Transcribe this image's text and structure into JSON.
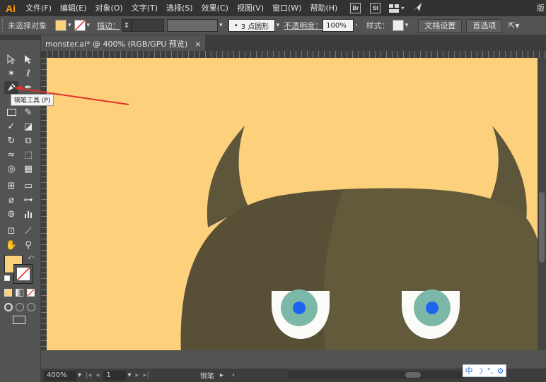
{
  "app": {
    "logo": "Ai"
  },
  "menu": {
    "items": [
      "文件(F)",
      "编辑(E)",
      "对象(O)",
      "文字(T)",
      "选择(S)",
      "效果(C)",
      "视图(V)",
      "窗口(W)",
      "帮助(H)"
    ],
    "bridge": "Br",
    "stock": "St",
    "right_text": "版"
  },
  "control": {
    "no_selection": "未选择对象",
    "fill_color": "#fdd17c",
    "stroke_label": "描边：",
    "brush_label": "3 点圆形",
    "opacity_label": "不透明度：",
    "opacity_value": "100%",
    "style_label": "样式：",
    "doc_settings": "文档设置",
    "preferences": "首选项"
  },
  "document": {
    "tab_title": "monster.ai* @ 400% (RGB/GPU 预览)",
    "close": "×"
  },
  "tooltip": "钢笔工具 (P)",
  "status": {
    "zoom": "400%",
    "artboard": "1",
    "tool_name": "钢笔"
  },
  "ime": {
    "lang": "中",
    "moon": "☽",
    "punct": "°,",
    "gear": "⚙"
  },
  "colors": {
    "canvas_bg": "#fdd17c",
    "monster_dark": "#5a5138",
    "monster_light": "#635a3c",
    "eye_white": "#fbfbf8",
    "iris": "#7bb8a8",
    "pupil": "#1e64ee",
    "annotation_arrow": "#e0302a"
  }
}
